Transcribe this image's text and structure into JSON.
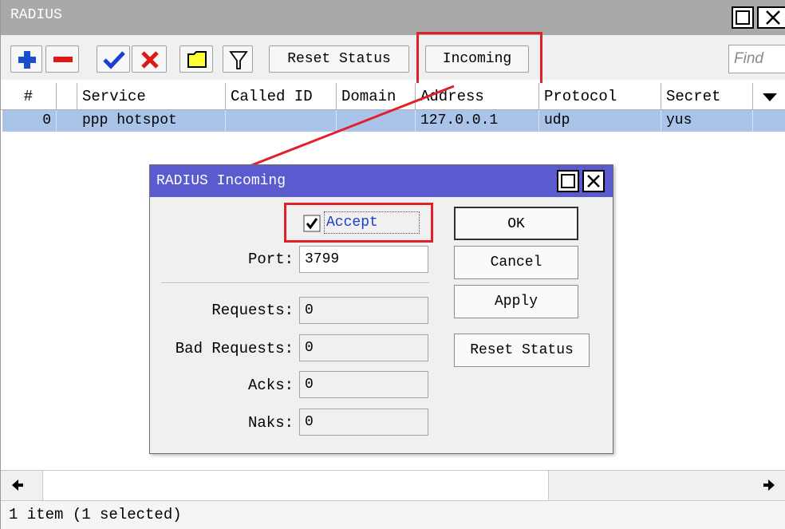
{
  "window": {
    "title": "RADIUS",
    "find_placeholder": "Find"
  },
  "toolbar": {
    "add_icon": "plus-icon",
    "remove_icon": "minus-icon",
    "enable_icon": "checkmark-icon",
    "disable_icon": "cross-icon",
    "comment_icon": "note-icon",
    "filter_icon": "filter-icon",
    "reset_status_label": "Reset Status",
    "incoming_label": "Incoming"
  },
  "table": {
    "columns": [
      "#",
      "Service",
      "Called ID",
      "Domain",
      "Address",
      "Protocol",
      "Secret"
    ],
    "rows": [
      {
        "num": "0",
        "service": "ppp hotspot",
        "called_id": "",
        "domain": "",
        "address": "127.0.0.1",
        "protocol": "udp",
        "secret": "yus"
      }
    ]
  },
  "status_bar": {
    "text": "1 item (1 selected)"
  },
  "dialog": {
    "title": "RADIUS Incoming",
    "accept_label": "Accept",
    "accept_checked": true,
    "port_label": "Port:",
    "port_value": "3799",
    "requests_label": "Requests:",
    "requests_value": "0",
    "bad_requests_label": "Bad Requests:",
    "bad_requests_value": "0",
    "acks_label": "Acks:",
    "acks_value": "0",
    "naks_label": "Naks:",
    "naks_value": "0",
    "ok_label": "OK",
    "cancel_label": "Cancel",
    "apply_label": "Apply",
    "reset_status_label": "Reset Status"
  },
  "colors": {
    "highlight": "#e0202a",
    "selected_row": "#a9c4e8",
    "dialog_titlebar": "#5b5bcf",
    "window_titlebar": "#a9a9a9"
  }
}
